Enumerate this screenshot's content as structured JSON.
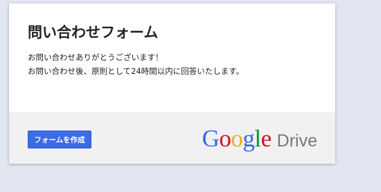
{
  "form": {
    "title": "問い合わせフォーム",
    "description_line1": "お問い合わせありがとうございます！",
    "description_line2": "お問い合わせ後、原則として24時間以内に回答いたします。"
  },
  "footer": {
    "create_button_label": "フォームを作成",
    "logo": {
      "google_letters": [
        "G",
        "o",
        "o",
        "g",
        "l",
        "e"
      ],
      "google_colors": [
        "#3369e8",
        "#d50f25",
        "#eeb211",
        "#3369e8",
        "#009925",
        "#d50f25"
      ],
      "product": "Drive"
    }
  }
}
